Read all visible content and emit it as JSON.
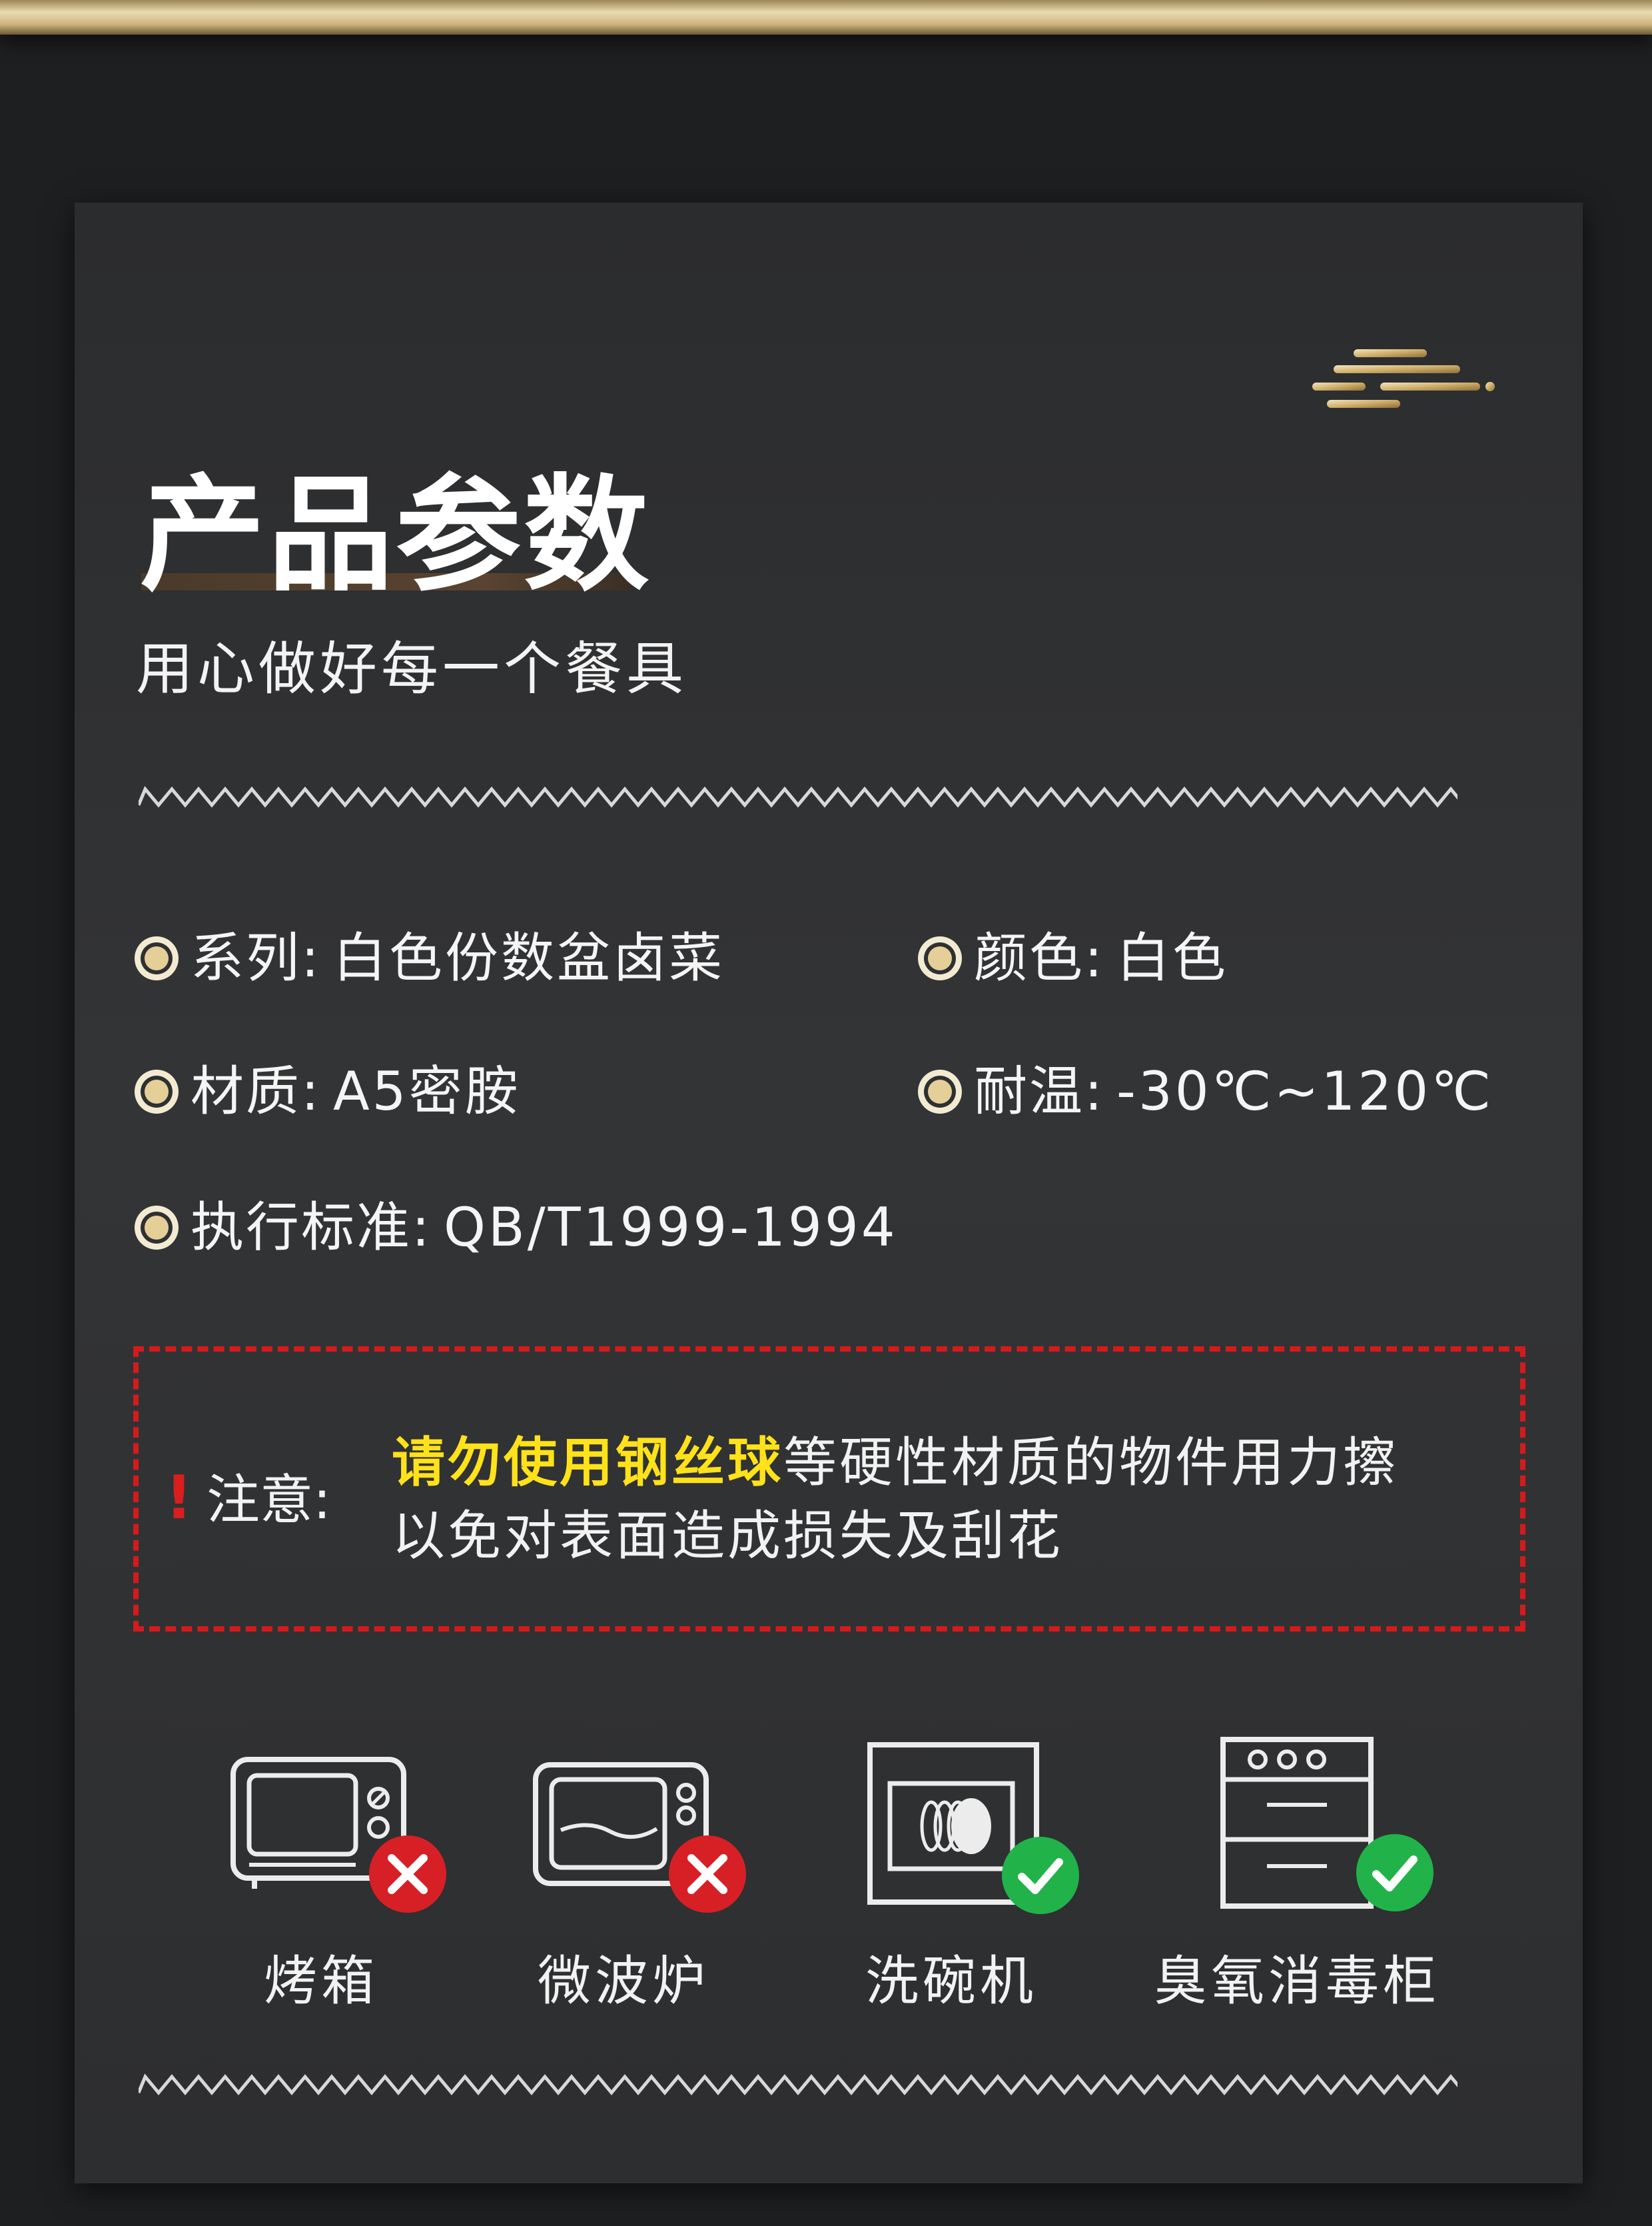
{
  "header": {
    "title": "产品参数",
    "subtitle": "用心做好每一个餐具"
  },
  "specs": [
    {
      "label": "系列:",
      "value": "白色份数盆卤菜"
    },
    {
      "label": "颜色:",
      "value": "白色"
    },
    {
      "label": "材质:",
      "value": "A5密胺"
    },
    {
      "label": "耐温:",
      "value": "-30℃~120℃"
    },
    {
      "label": "执行标准:",
      "value": "QB/T1999-1994"
    }
  ],
  "notice": {
    "mark": "!",
    "label": "注意:",
    "highlight": "请勿使用钢丝球",
    "text_line1_rest": "等硬性材质的物件用力擦",
    "text_line2": "以免对表面造成损失及刮花"
  },
  "appliances": [
    {
      "label": "烤箱",
      "icon": "oven-icon",
      "status": "not-suitable"
    },
    {
      "label": "微波炉",
      "icon": "microwave-icon",
      "status": "not-suitable"
    },
    {
      "label": "洗碗机",
      "icon": "dishwasher-icon",
      "status": "suitable"
    },
    {
      "label": "臭氧消毒柜",
      "icon": "disinfection-cabinet-icon",
      "status": "suitable"
    }
  ],
  "colors": {
    "background": "#1e1f21",
    "card": "#2f3032",
    "gold": "#d9c48f",
    "notice_border": "#d41b1b",
    "highlight": "#ffe21a",
    "cross": "#d71f26",
    "check": "#21b34a"
  }
}
